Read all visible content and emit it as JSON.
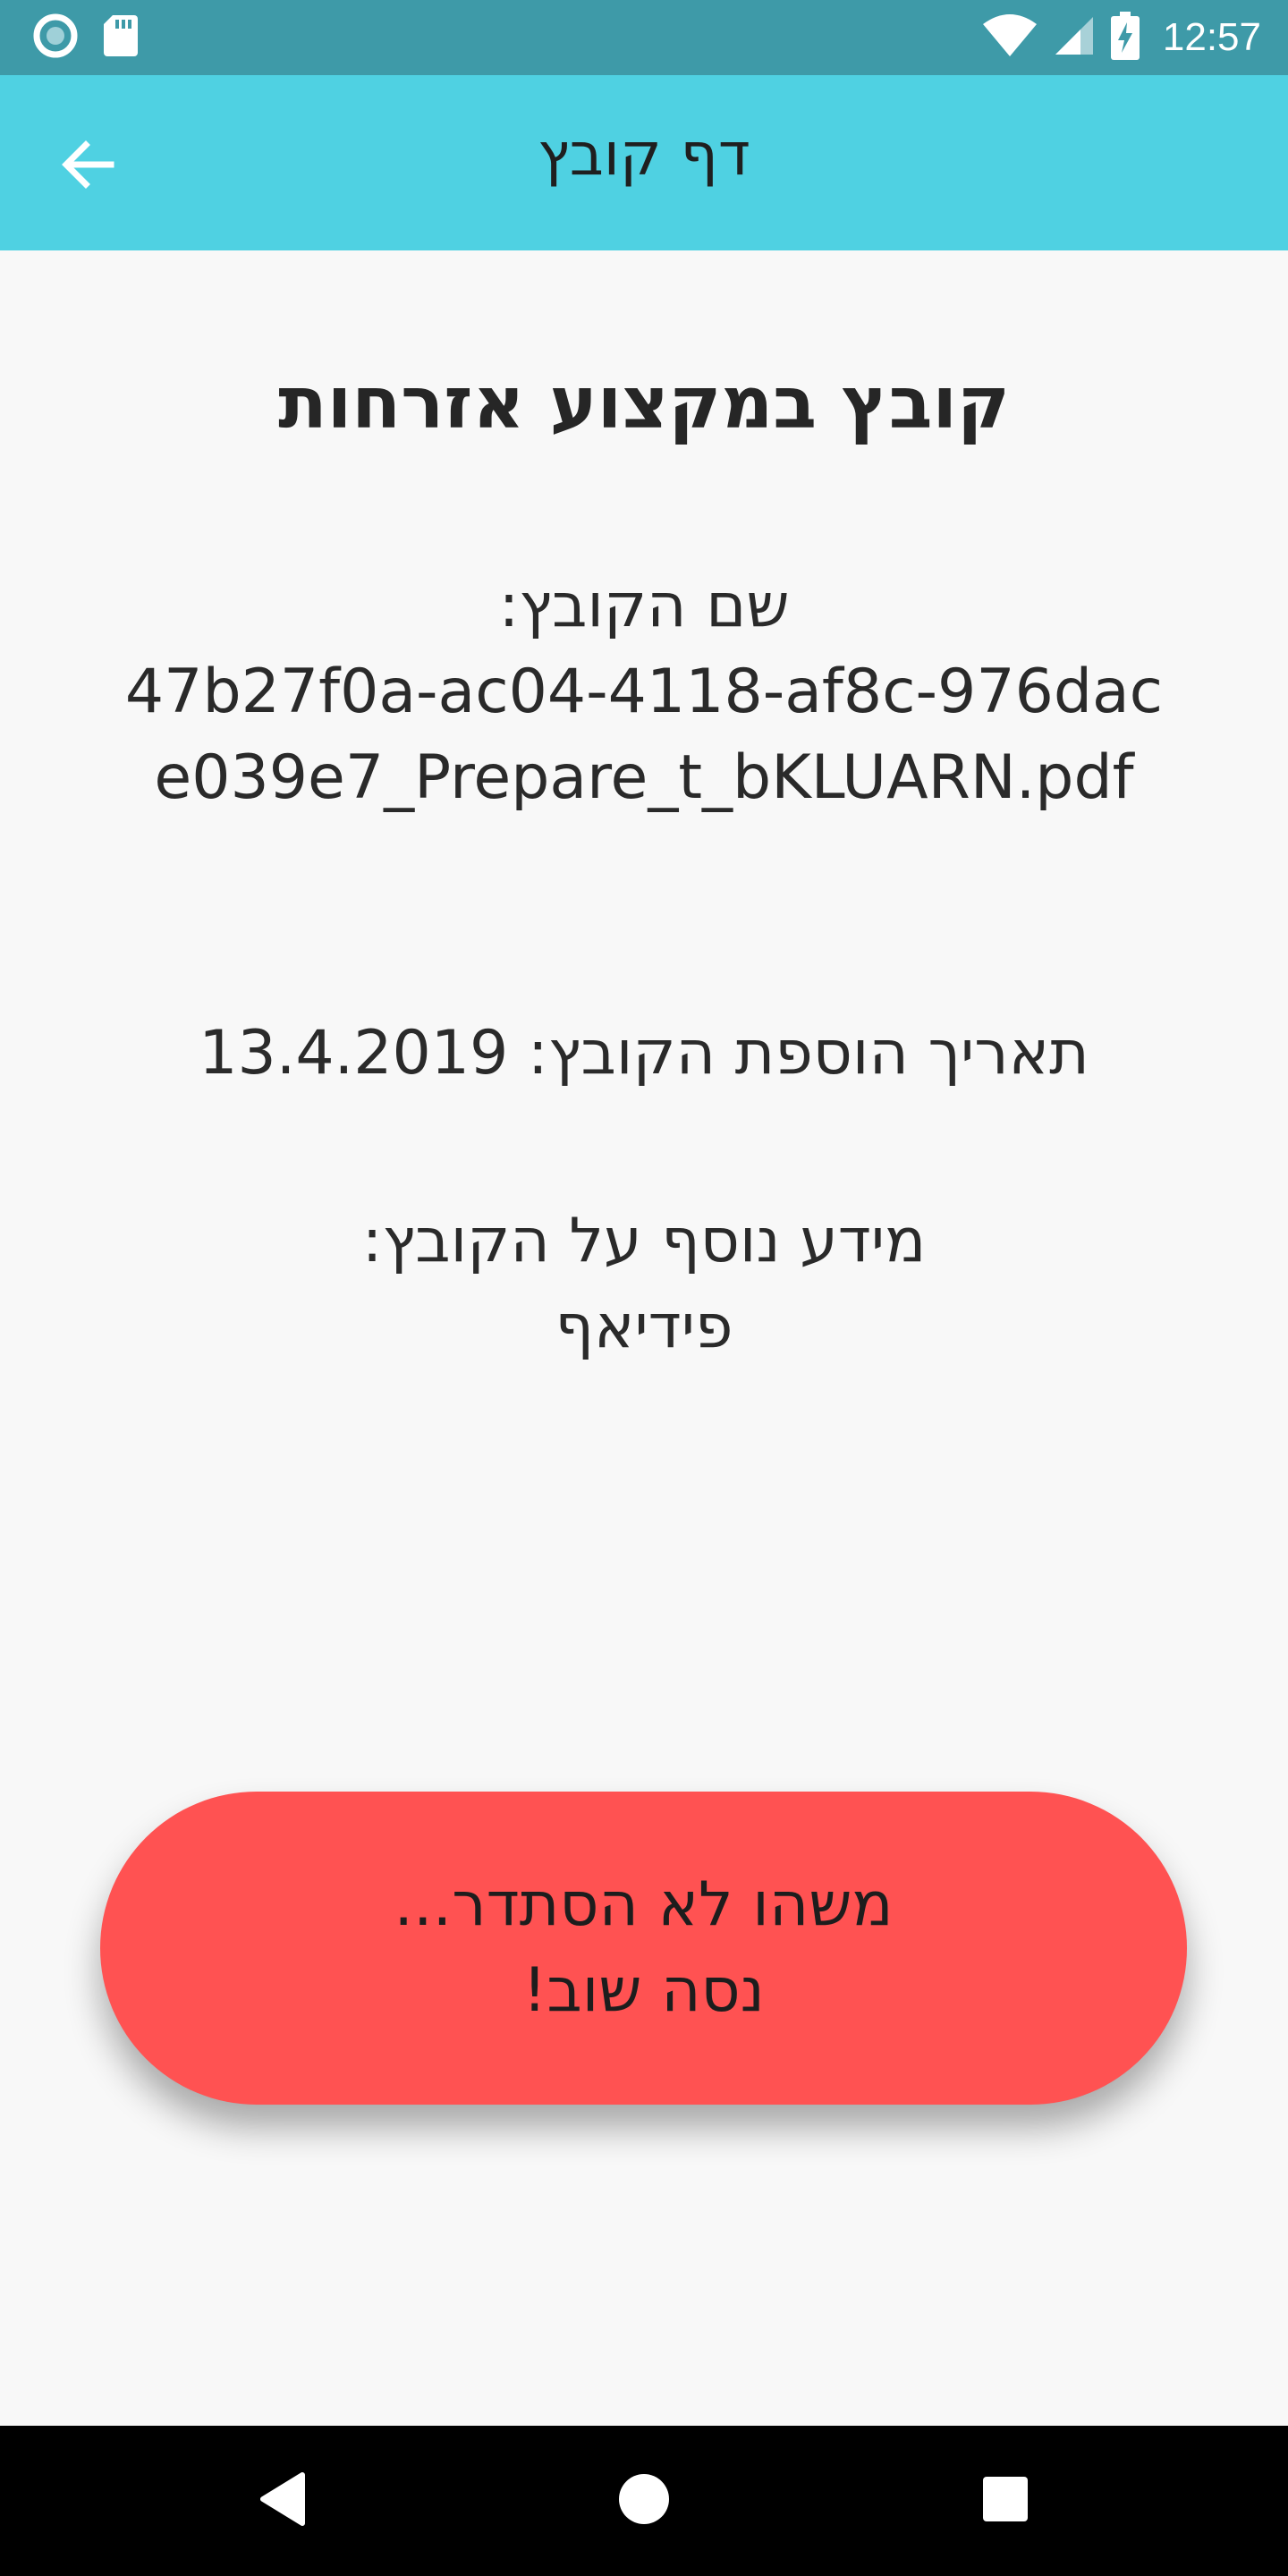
{
  "status_bar": {
    "time": "12:57",
    "icons": [
      "sync-circle-icon",
      "sd-card-icon",
      "wifi-icon",
      "signal-icon",
      "battery-charging-icon"
    ],
    "background": "#3e9aa8"
  },
  "app_bar": {
    "title": "דף קובץ",
    "back_icon": "arrow-left-icon",
    "background": "#4fd1e2"
  },
  "file": {
    "heading": "קובץ במקצוע אזרחות",
    "name_label": "שם הקובץ:",
    "name_value": "47b27f0a-ac04-4118-af8c-976dace039e7_Prepare_t_bKLUARN.pdf",
    "date_label": "תאריך הוספת הקובץ:",
    "date_value": "13.4.2019",
    "extra_label": "מידע נוסף על הקובץ:",
    "extra_value": "פידיאף"
  },
  "error_toast": {
    "line1": "משהו לא הסתדר...",
    "line2": "נסה שוב!",
    "color": "#ff5252"
  },
  "nav_bar": {
    "icons": [
      "back-triangle-icon",
      "home-circle-icon",
      "recents-square-icon"
    ]
  }
}
